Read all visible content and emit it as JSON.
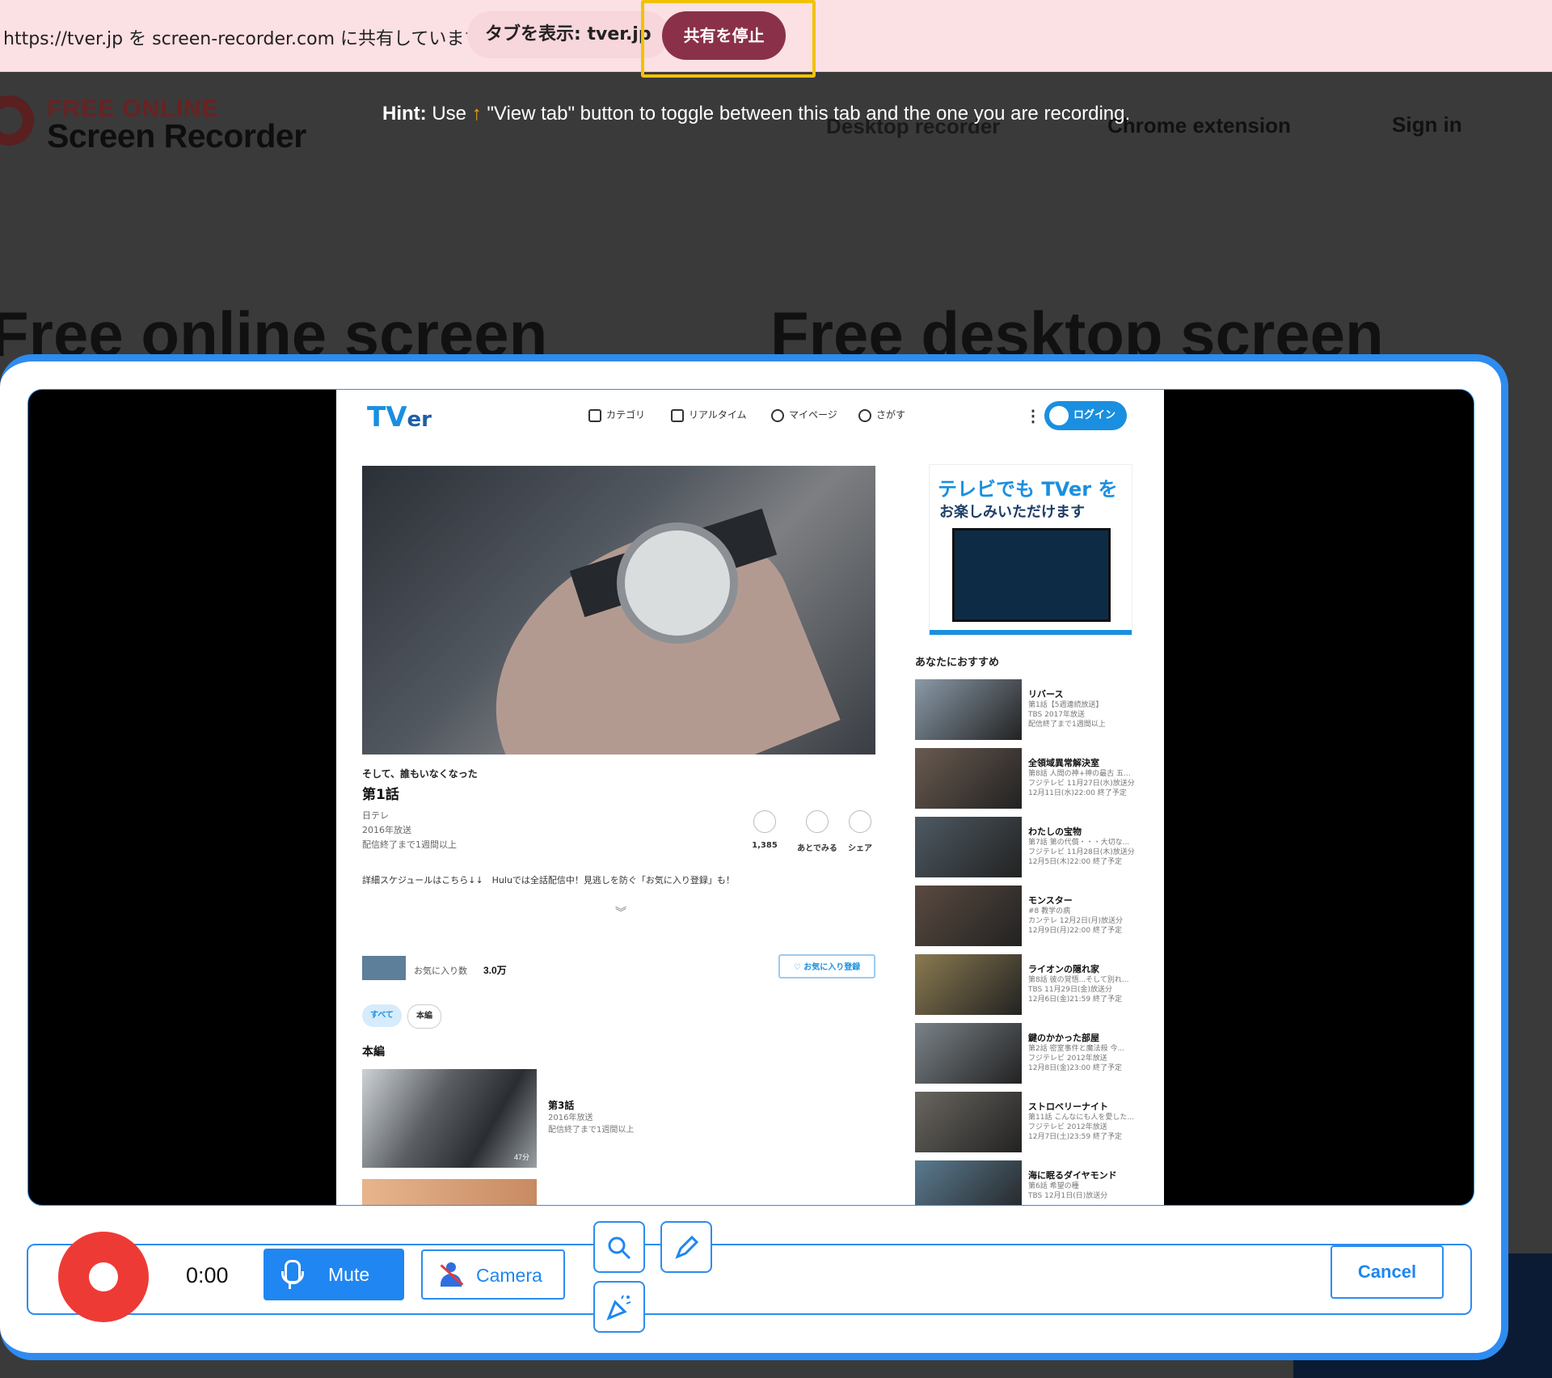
{
  "share_bar": {
    "text": "https://tver.jp を screen-recorder.com に共有しています",
    "view_tab_label": "タブを表示: tver.jp",
    "stop_label": "共有を停止",
    "highlight_color": "#f2c200"
  },
  "site": {
    "logo_top": "FREE ONLINE",
    "logo_bottom": "Screen Recorder",
    "hint_bold": "Hint:",
    "hint_pre": "Use",
    "hint_arrow": "↑",
    "hint_text": "\"View tab\" button to toggle between this tab and the one you are recording.",
    "nav": {
      "desktop": "Desktop recorder",
      "extension": "Chrome extension",
      "signin": "Sign in"
    },
    "hero_left": "Free online screen",
    "hero_right": "Free desktop screen"
  },
  "tver": {
    "logo_main": "TV",
    "logo_sub": "er",
    "nav": {
      "category": "カテゴリ",
      "realtime": "リアルタイム",
      "mypage": "マイページ",
      "search": "さがす"
    },
    "login": "ログイン",
    "episode": {
      "series": "そして、誰もいなくなった",
      "title": "第1話",
      "network": "日テレ",
      "year": "2016年放送",
      "availability": "配信終了まで1週間以上"
    },
    "actions": {
      "likes": "1,385",
      "later": "あとでみる",
      "share": "シェア"
    },
    "description": "詳細スケジュールはこちら↓↓　Huluでは全話配信中！見逃しを防ぐ「お気に入り登録」も！",
    "favorite": {
      "label": "お気に入り数",
      "count": "3.0万",
      "button": "お気に入り登録"
    },
    "filters": {
      "all": "すべて",
      "main": "本編"
    },
    "section_main": "本編",
    "ep3": {
      "title": "第3話",
      "year": "2016年放送",
      "availability": "配信終了まで1週間以上",
      "duration": "47分"
    },
    "promo": {
      "line1": "テレビでも TVer を",
      "line2": "お楽しみいただけます"
    },
    "recommend_title": "あなたにおすすめ",
    "recommendations": [
      {
        "name": "リバース",
        "desc": "第1話【5週連続放送】",
        "meta": "TBS 2017年放送",
        "avail": "配信終了まで1週間以上",
        "color": "#8a9aa8"
      },
      {
        "name": "全領域異常解決室",
        "desc": "第8話 人間の神+神の最古 五...",
        "meta": "フジテレビ 11月27日(水)放送分",
        "avail": "12月11日(水)22:00 終了予定",
        "color": "#6a5a50"
      },
      {
        "name": "わたしの宝物",
        "desc": "第7話 第の代償・・・大切な...",
        "meta": "フジテレビ 11月28日(木)放送分",
        "avail": "12月5日(木)22:00 終了予定",
        "color": "#4e5a63"
      },
      {
        "name": "モンスター",
        "desc": "#8 教学の病",
        "meta": "カンテレ 12月2日(月)放送分",
        "avail": "12月9日(月)22:00 終了予定",
        "color": "#5a4a40"
      },
      {
        "name": "ライオンの隠れ家",
        "desc": "第8話 彼の覚悟...そして別れ...",
        "meta": "TBS 11月29日(金)放送分",
        "avail": "12月6日(金)21:59 終了予定",
        "color": "#8a7a50"
      },
      {
        "name": "鍵のかかった部屋",
        "desc": "第2話 密室事件と魔法殺 今...",
        "meta": "フジテレビ 2012年放送",
        "avail": "12月8日(金)23:00 終了予定",
        "color": "#7a8288"
      },
      {
        "name": "ストロベリーナイト",
        "desc": "第11話 こんなにも人を愛した...",
        "meta": "フジテレビ 2012年放送",
        "avail": "12月7日(土)23:59 終了予定",
        "color": "#6a6660"
      },
      {
        "name": "海に眠るダイヤモンド",
        "desc": "第6話 希望の種",
        "meta": "TBS 12月1日(日)放送分",
        "avail": "",
        "color": "#5a7a90"
      }
    ]
  },
  "controls": {
    "timer": "0:00",
    "mute_label": "Mute",
    "camera_label": "Camera",
    "cancel_label": "Cancel",
    "record_color": "#ee3a35",
    "accent": "#1f86f2"
  }
}
